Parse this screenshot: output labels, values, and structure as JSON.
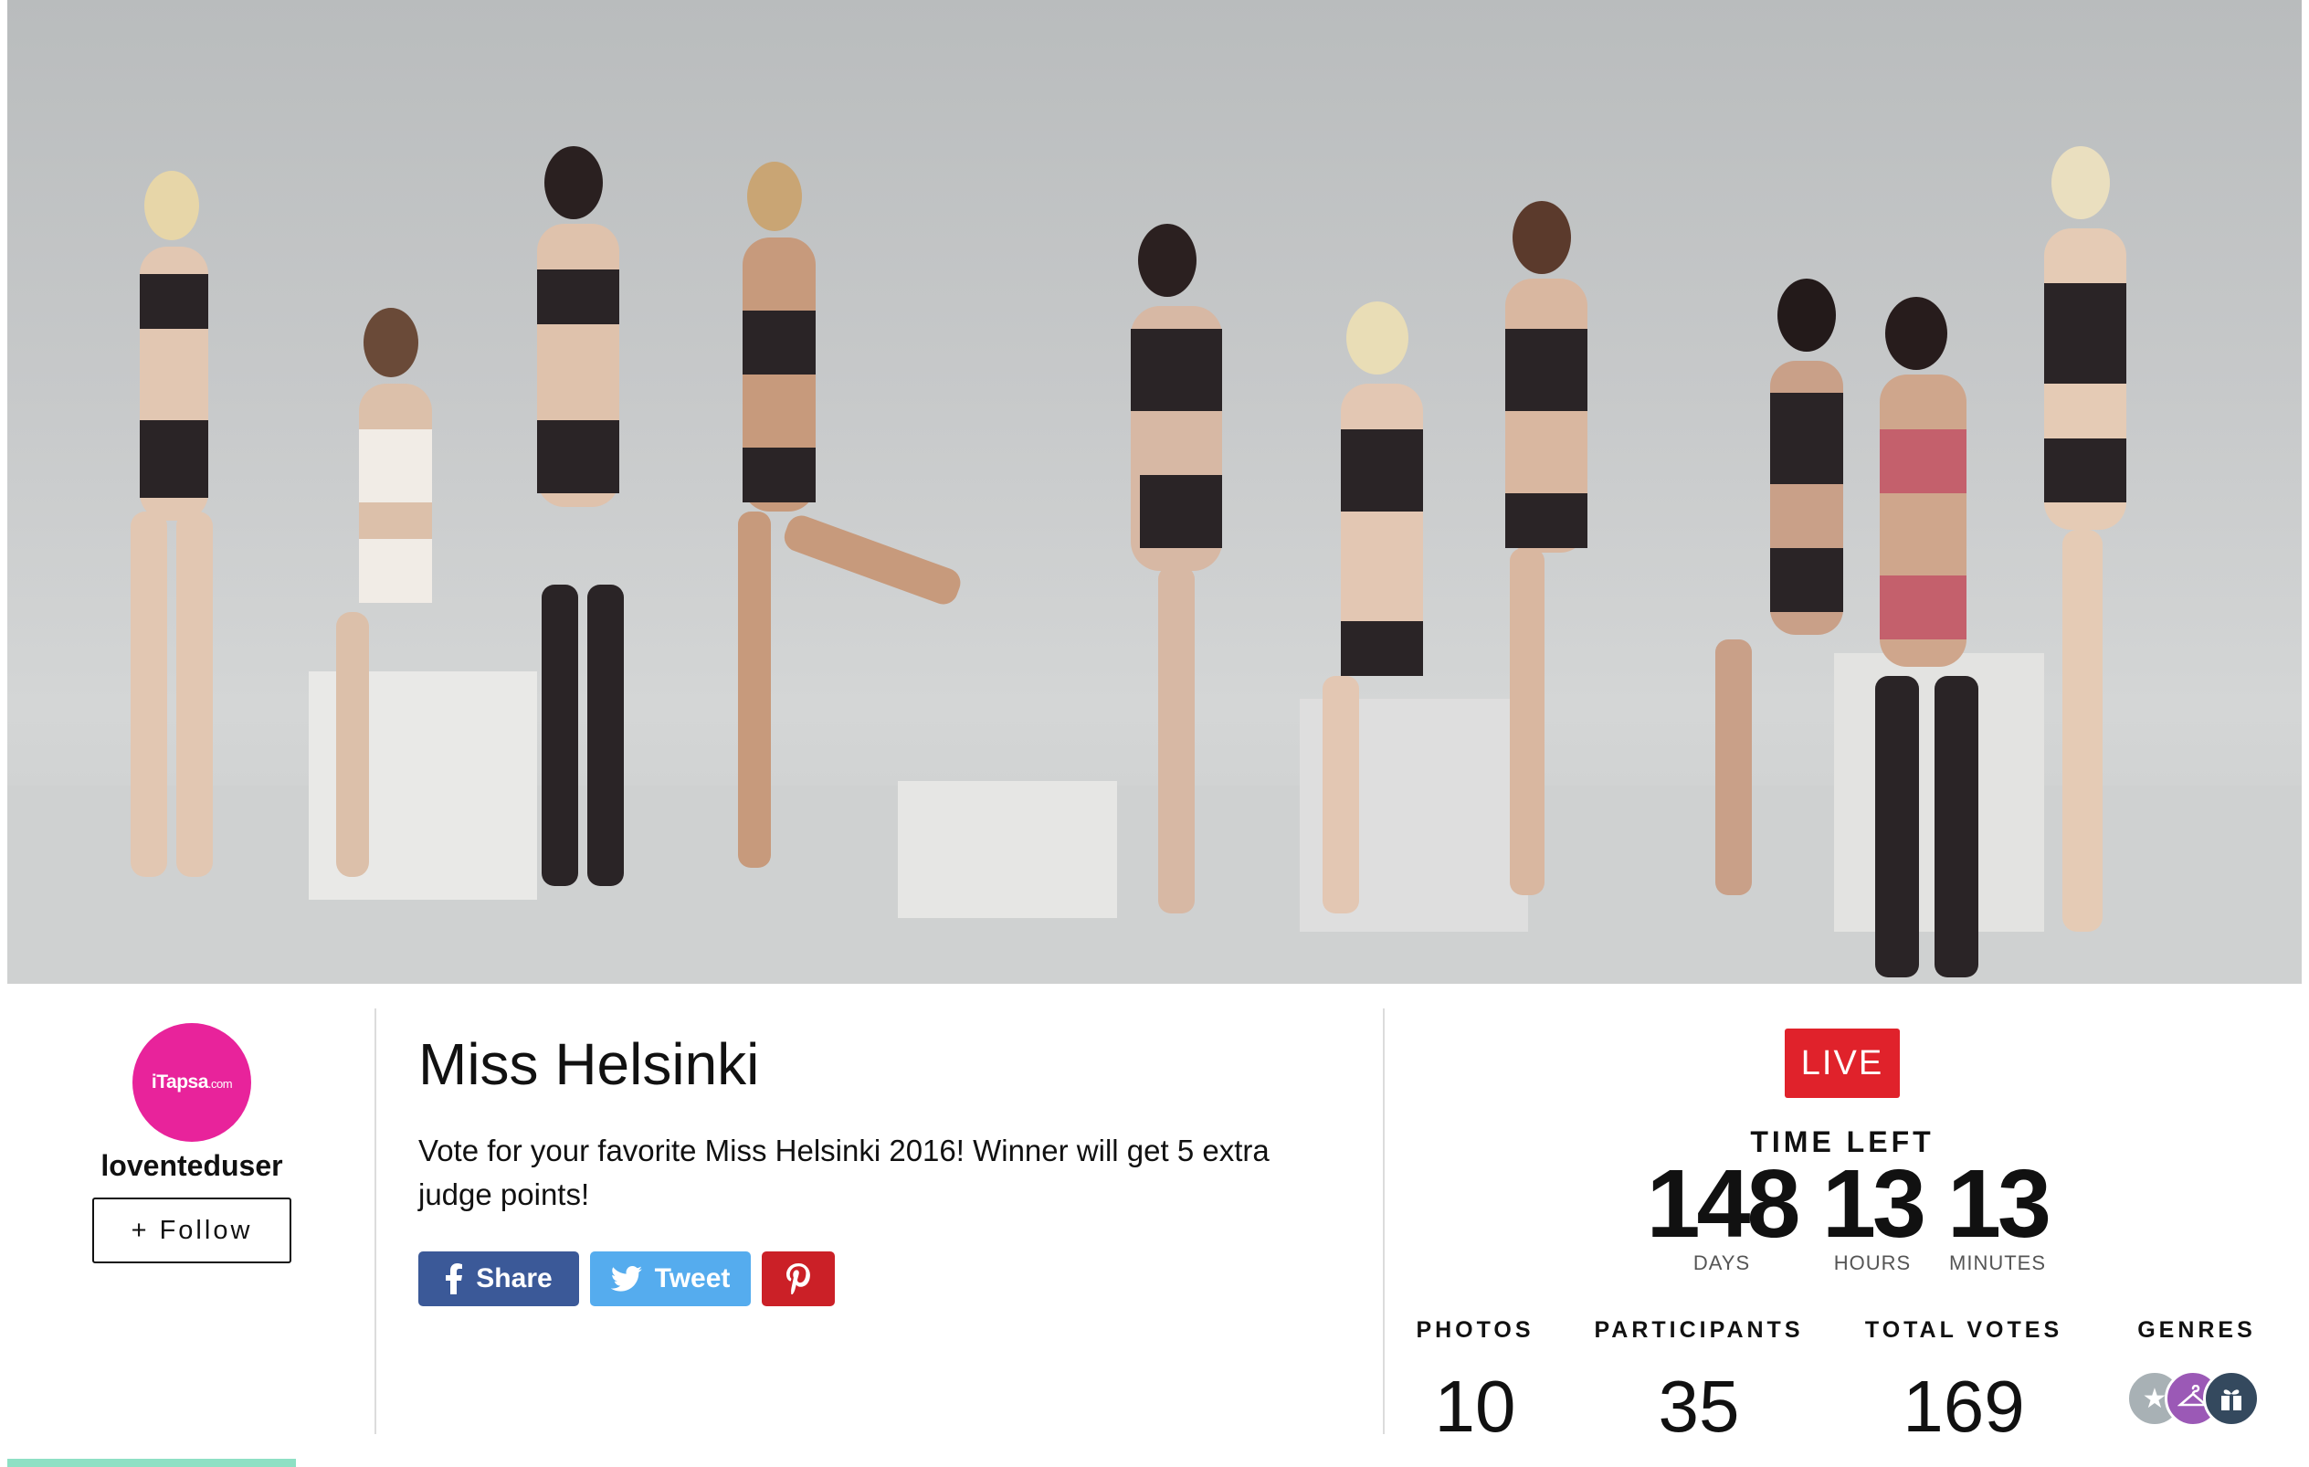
{
  "profile": {
    "logo_text": "iTapsa",
    "logo_suffix": ".com",
    "username": "loventeduser",
    "follow_label": "+ Follow"
  },
  "contest": {
    "title": "Miss Helsinki",
    "description": "Vote for your favorite Miss Helsinki 2016! Winner will get 5 extra judge points!"
  },
  "share": {
    "facebook_label": "Share",
    "twitter_label": "Tweet"
  },
  "status": {
    "live_label": "LIVE",
    "time_left_label": "TIME LEFT",
    "days": "148",
    "days_label": "DAYS",
    "hours": "13",
    "hours_label": "HOURS",
    "minutes": "13",
    "minutes_label": "MINUTES"
  },
  "stats": {
    "photos_label": "PHOTOS",
    "photos": "10",
    "participants_label": "PARTICIPANTS",
    "participants": "35",
    "votes_label": "TOTAL VOTES",
    "votes": "169",
    "genres_label": "GENRES"
  },
  "genre_icons": [
    "star-icon",
    "hanger-icon",
    "gift-icon"
  ],
  "colors": {
    "brand_pink": "#e8239b",
    "live_red": "#e0222b",
    "facebook": "#3b5998",
    "twitter": "#55acee",
    "pinterest": "#cb2027",
    "accent_green": "#8ee0c4"
  }
}
